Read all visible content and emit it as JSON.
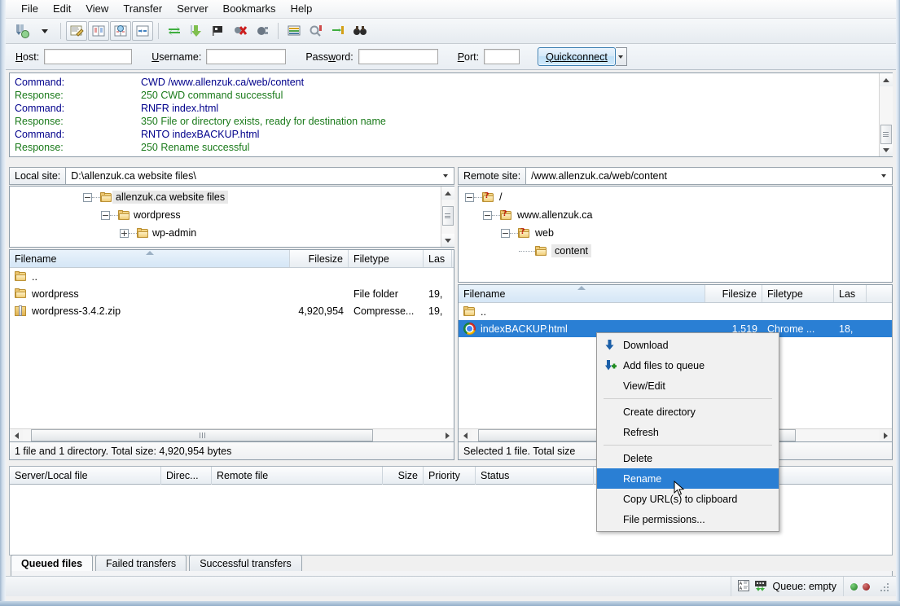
{
  "menu": {
    "items": [
      "File",
      "Edit",
      "View",
      "Transfer",
      "Server",
      "Bookmarks",
      "Help"
    ]
  },
  "toolbar": {
    "icons": [
      "site-manager-icon",
      "dropdown-caret-icon",
      "toggle-message-log-icon",
      "toggle-local-tree-icon",
      "toggle-remote-tree-icon",
      "toggle-transfer-queue-icon",
      "refresh-icon",
      "process-queue-icon",
      "cancel-operation-icon",
      "disconnect-icon",
      "reconnect-icon",
      "filter-icon",
      "compare-directories-icon",
      "synchronized-browsing-icon",
      "search-remote-files-icon"
    ]
  },
  "quickconnect": {
    "host_label": "Host:",
    "host_value": "",
    "username_label": "Username:",
    "username_value": "",
    "password_label": "Password:",
    "password_value": "",
    "port_label": "Port:",
    "port_value": "",
    "button_label": "Quickconnect"
  },
  "log": {
    "rows": [
      {
        "type": "cmd",
        "label": "Command:",
        "text": "CWD /www.allenzuk.ca/web/content"
      },
      {
        "type": "resp",
        "label": "Response:",
        "text": "250 CWD command successful"
      },
      {
        "type": "cmd",
        "label": "Command:",
        "text": "RNFR index.html"
      },
      {
        "type": "resp",
        "label": "Response:",
        "text": "350 File or directory exists, ready for destination name"
      },
      {
        "type": "cmd",
        "label": "Command:",
        "text": "RNTO indexBACKUP.html"
      },
      {
        "type": "resp",
        "label": "Response:",
        "text": "250 Rename successful"
      }
    ]
  },
  "local": {
    "site_label": "Local site:",
    "site_path": "D:\\allenzuk.ca website files\\",
    "tree": [
      {
        "label": "allenzuk.ca website files",
        "depth": 0,
        "expander": "-",
        "selected": true
      },
      {
        "label": "wordpress",
        "depth": 1,
        "expander": "-",
        "selected": false
      },
      {
        "label": "wp-admin",
        "depth": 2,
        "expander": "+",
        "selected": false
      }
    ],
    "columns": [
      "Filename",
      "Filesize",
      "Filetype",
      "Las"
    ],
    "rows": [
      {
        "icon": "folder-icon",
        "name": "..",
        "size": "",
        "type": "",
        "modified": ""
      },
      {
        "icon": "folder-icon",
        "name": "wordpress",
        "size": "",
        "type": "File folder",
        "modified": "19,"
      },
      {
        "icon": "zip-icon",
        "name": "wordpress-3.4.2.zip",
        "size": "4,920,954",
        "type": "Compresse...",
        "modified": "19,"
      }
    ],
    "status": "1 file and 1 directory. Total size: 4,920,954 bytes"
  },
  "remote": {
    "site_label": "Remote site:",
    "site_path": "/www.allenzuk.ca/web/content",
    "tree": [
      {
        "label": "/",
        "depth": 0,
        "expander": "-",
        "icon": "folder-unknown-icon",
        "selected": false
      },
      {
        "label": "www.allenzuk.ca",
        "depth": 1,
        "expander": "-",
        "icon": "folder-unknown-icon",
        "selected": false
      },
      {
        "label": "web",
        "depth": 2,
        "expander": "-",
        "icon": "folder-unknown-icon",
        "selected": false
      },
      {
        "label": "content",
        "depth": 3,
        "expander": "",
        "icon": "folder-icon",
        "selected": true
      }
    ],
    "columns": [
      "Filename",
      "Filesize",
      "Filetype",
      "Las"
    ],
    "rows": [
      {
        "icon": "folder-icon",
        "name": "..",
        "size": "",
        "type": "",
        "modified": "",
        "selected": false
      },
      {
        "icon": "chrome-icon",
        "name": "indexBACKUP.html",
        "size": "1,519",
        "type": "Chrome ...",
        "modified": "18,",
        "selected": true
      }
    ],
    "status": "Selected 1 file. Total size"
  },
  "context_menu": {
    "items": [
      {
        "label": "Download",
        "icon": "download-arrow-icon",
        "highlight": false,
        "separator_after": false
      },
      {
        "label": "Add files to queue",
        "icon": "add-to-queue-icon",
        "highlight": false,
        "separator_after": false
      },
      {
        "label": "View/Edit",
        "icon": "",
        "highlight": false,
        "separator_after": true
      },
      {
        "label": "Create directory",
        "icon": "",
        "highlight": false,
        "separator_after": false
      },
      {
        "label": "Refresh",
        "icon": "",
        "highlight": false,
        "separator_after": true
      },
      {
        "label": "Delete",
        "icon": "",
        "highlight": false,
        "separator_after": false
      },
      {
        "label": "Rename",
        "icon": "",
        "highlight": true,
        "separator_after": false
      },
      {
        "label": "Copy URL(s) to clipboard",
        "icon": "",
        "highlight": false,
        "separator_after": false
      },
      {
        "label": "File permissions...",
        "icon": "",
        "highlight": false,
        "separator_after": false
      }
    ]
  },
  "queue": {
    "columns": [
      "Server/Local file",
      "Direc...",
      "Remote file",
      "Size",
      "Priority",
      "Status"
    ],
    "rows": []
  },
  "tabs": [
    {
      "label": "Queued files",
      "active": true
    },
    {
      "label": "Failed transfers",
      "active": false
    },
    {
      "label": "Successful transfers",
      "active": false
    }
  ],
  "statusbar": {
    "icons": [
      "ascii-transfer-icon",
      "queue-transfer-icon"
    ],
    "queue_text": "Queue: empty",
    "led_green": "#2a8a2a",
    "led_red": "#9c1b1b"
  },
  "colors": {
    "selection_blue": "#2a7fd4",
    "command_blue": "#00008b",
    "response_green": "#1a7a1a"
  }
}
